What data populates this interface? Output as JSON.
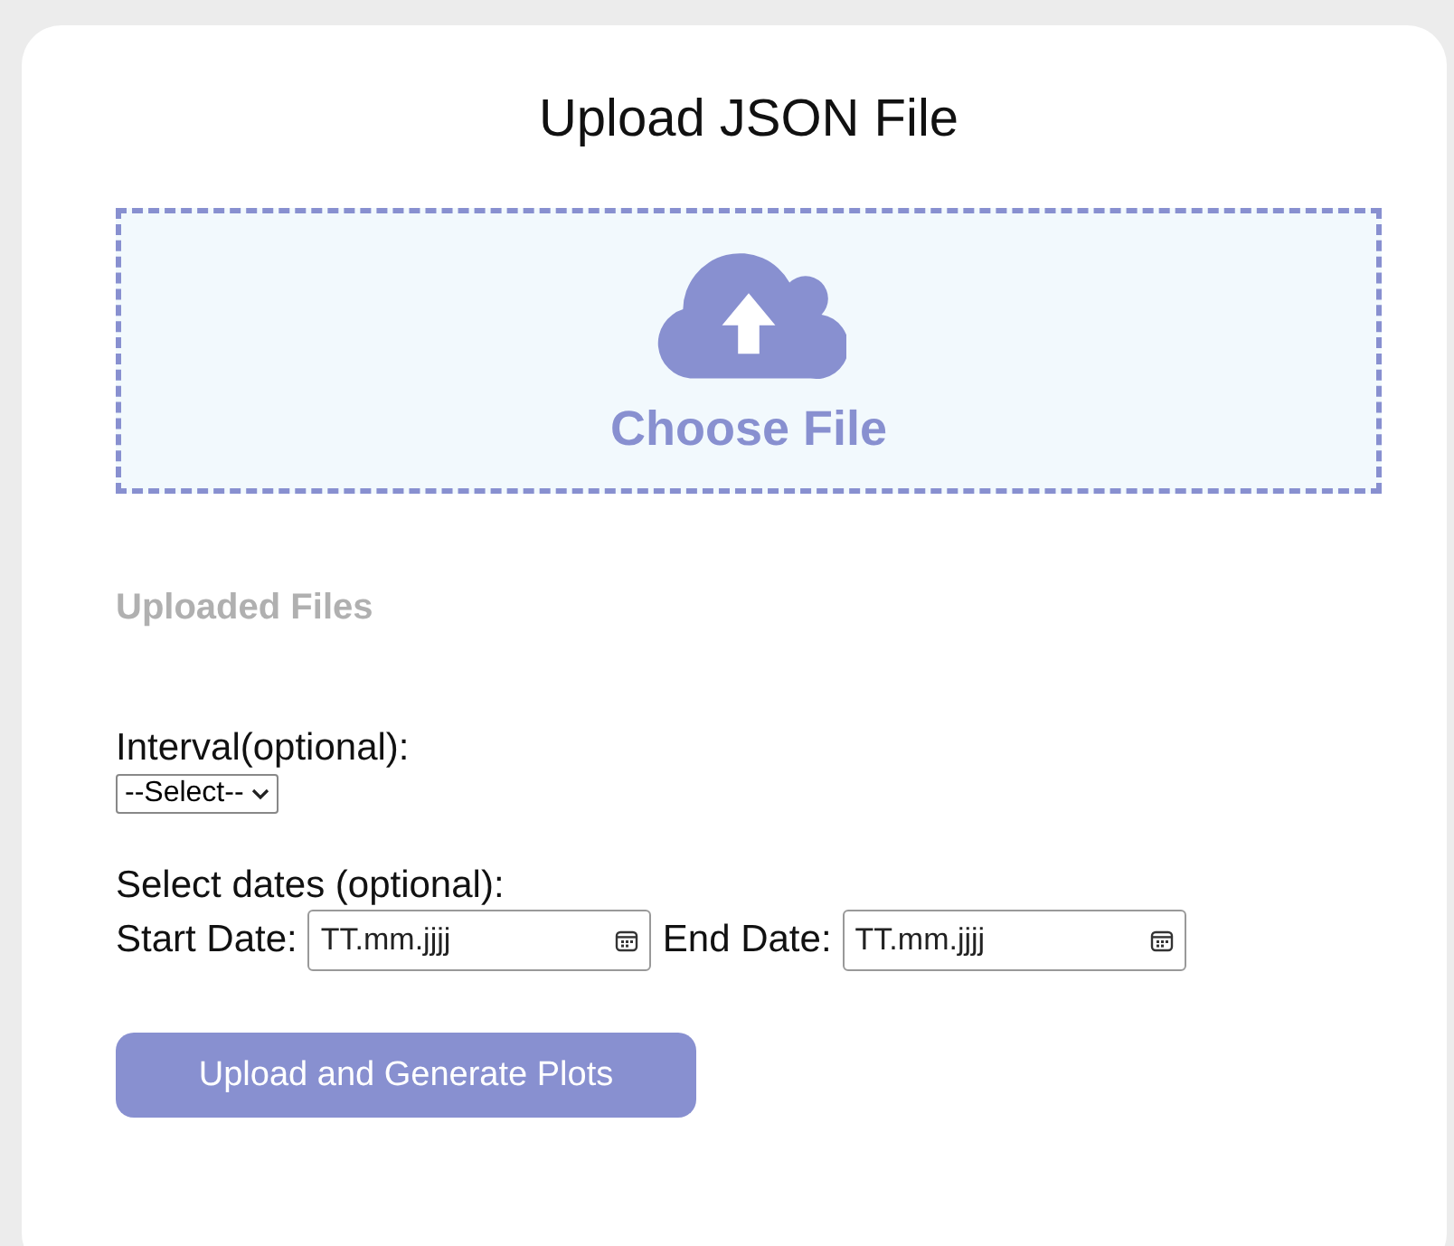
{
  "title": "Upload JSON File",
  "dropzone": {
    "label": "Choose File"
  },
  "uploaded_files": {
    "heading": "Uploaded Files"
  },
  "interval": {
    "label": "Interval(optional):",
    "value": "--Select--"
  },
  "dates": {
    "label": "Select dates (optional):",
    "fields": [
      {
        "label": "Start Date:",
        "placeholder": "TT.mm.jjjj"
      },
      {
        "label": "End Date:",
        "placeholder": "TT.mm.jjjj"
      }
    ]
  },
  "submit": {
    "label": "Upload and Generate Plots"
  }
}
